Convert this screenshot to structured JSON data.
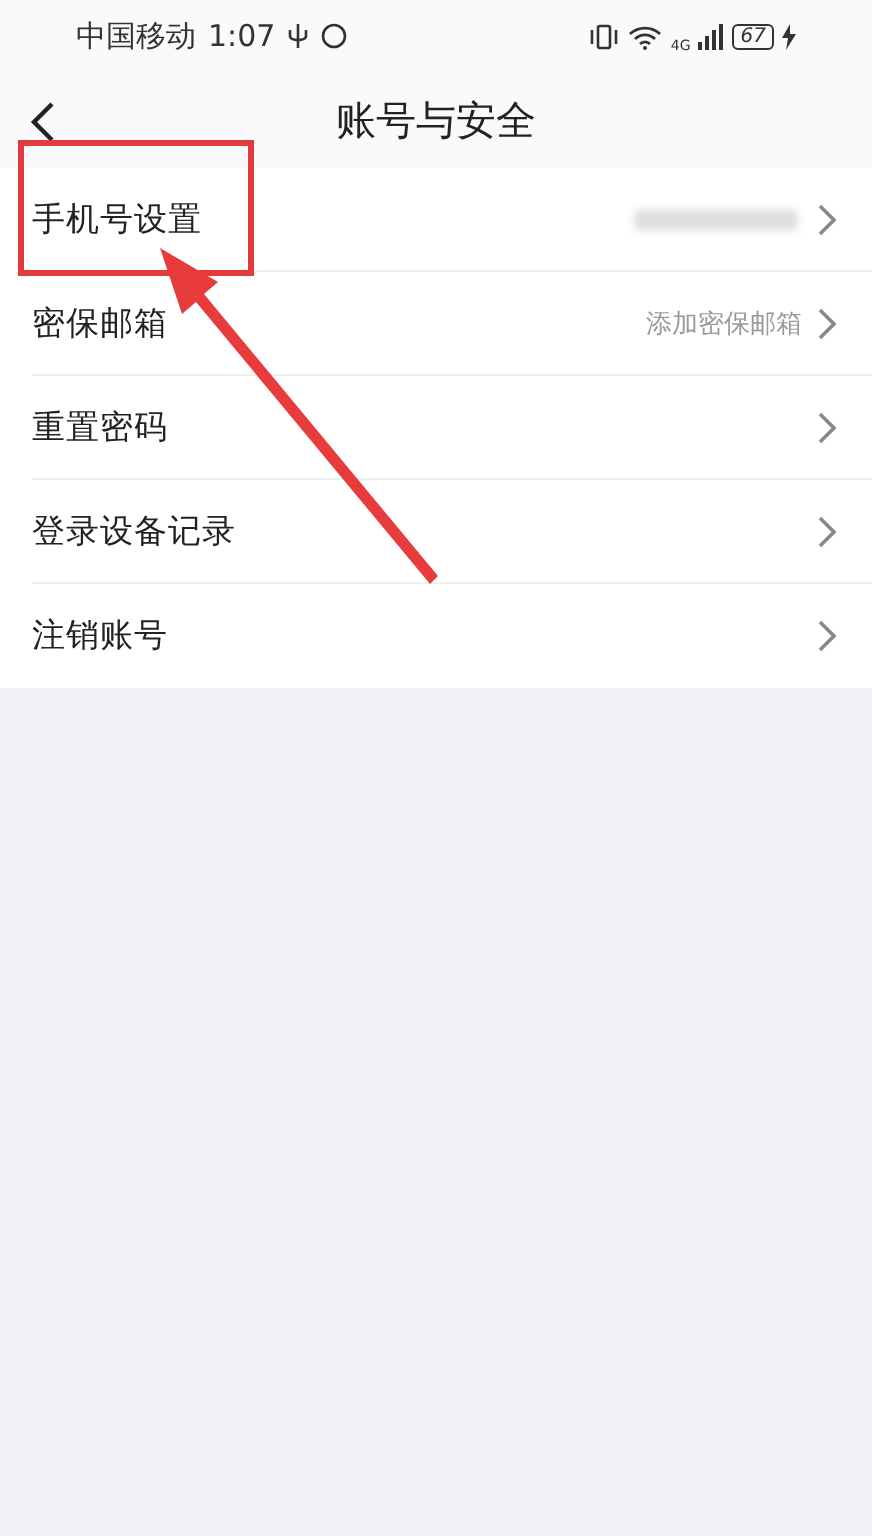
{
  "status_bar": {
    "carrier": "中国移动",
    "time": "1:07",
    "network": "4G",
    "battery": "67"
  },
  "header": {
    "title": "账号与安全"
  },
  "rows": [
    {
      "label": "手机号设置",
      "kind": "redacted",
      "highlighted": true
    },
    {
      "label": "密保邮箱",
      "kind": "value",
      "value": "添加密保邮箱",
      "highlighted": false
    },
    {
      "label": "重置密码",
      "kind": "plain",
      "highlighted": false
    },
    {
      "label": "登录设备记录",
      "kind": "plain",
      "highlighted": false
    },
    {
      "label": "注销账号",
      "kind": "plain",
      "highlighted": false
    }
  ]
}
